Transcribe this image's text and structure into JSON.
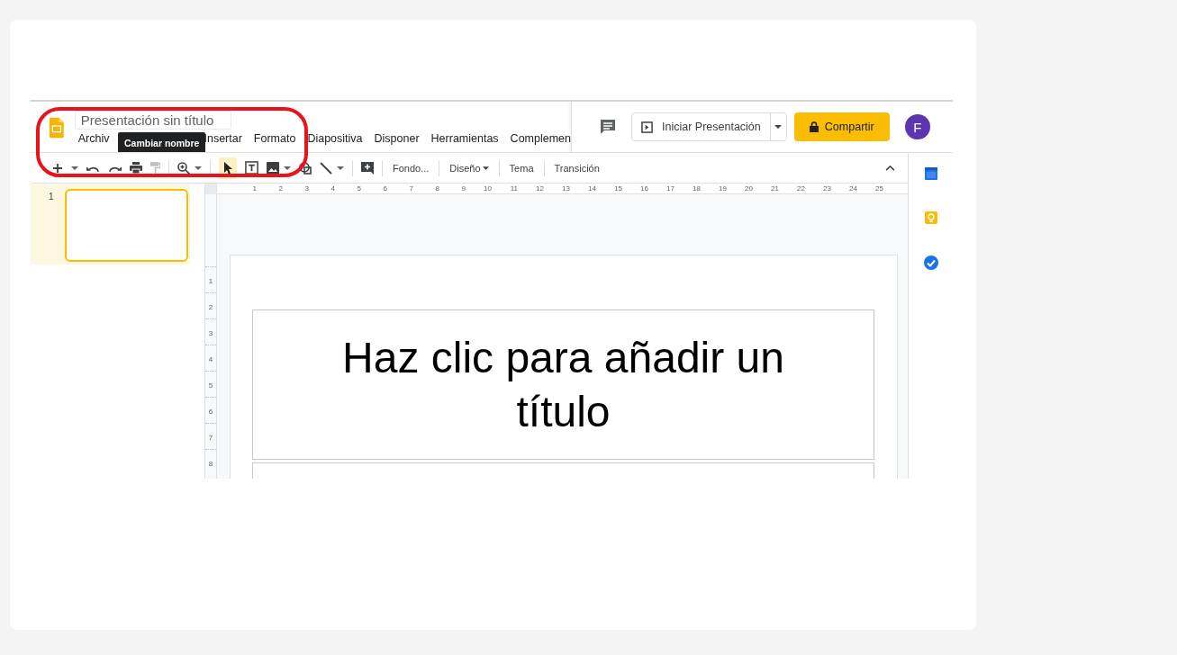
{
  "header": {
    "title": "Presentación sin título",
    "tooltip": "Cambiar nombre",
    "menu": [
      "Archiv",
      "Insertar",
      "Formato",
      "Diapositiva",
      "Disponer",
      "Herramientas",
      "Complemen"
    ]
  },
  "actions": {
    "present": "Iniciar Presentación",
    "share": "Compartir",
    "avatar": "F"
  },
  "toolbar": {
    "select_tool_selected": true,
    "text_buttons": [
      {
        "label": "Fondo...",
        "dropdown": false
      },
      {
        "label": "Diseño",
        "dropdown": true
      },
      {
        "label": "Tema",
        "dropdown": false
      },
      {
        "label": "Transición",
        "dropdown": false
      }
    ]
  },
  "filmstrip": {
    "slides": [
      {
        "number": "1",
        "selected": true
      }
    ]
  },
  "rulers": {
    "horizontal": [
      "1",
      "2",
      "3",
      "4",
      "5",
      "6",
      "7",
      "8",
      "9",
      "10",
      "11",
      "12",
      "13",
      "14",
      "15",
      "16",
      "17",
      "18",
      "19",
      "20",
      "21",
      "22",
      "23",
      "24",
      "25"
    ],
    "vertical": [
      "1",
      "2",
      "3",
      "4",
      "5",
      "6",
      "7",
      "8"
    ]
  },
  "slide": {
    "title_placeholder": "Haz clic para añadir un título"
  },
  "annotations": [
    {
      "kind": "ellipse"
    }
  ]
}
